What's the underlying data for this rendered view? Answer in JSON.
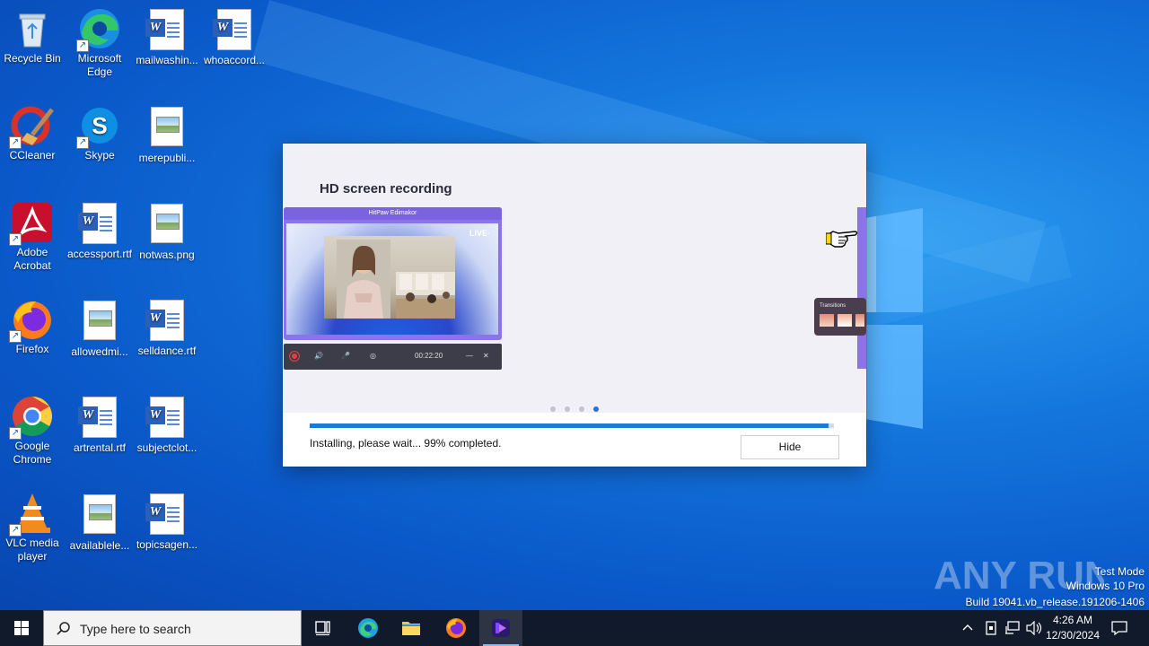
{
  "desktop": {
    "icons": [
      {
        "name": "recycle-bin",
        "label": "Recycle Bin",
        "kind": "recycle"
      },
      {
        "name": "microsoft-edge",
        "label": "Microsoft Edge",
        "kind": "edge"
      },
      {
        "name": "mailwashin",
        "label": "mailwashin...",
        "kind": "word"
      },
      {
        "name": "whoaccord",
        "label": "whoaccord...",
        "kind": "word"
      },
      {
        "name": "ccleaner",
        "label": "CCleaner",
        "kind": "ccleaner"
      },
      {
        "name": "skype",
        "label": "Skype",
        "kind": "skype"
      },
      {
        "name": "merepubli",
        "label": "merepubli...",
        "kind": "image"
      },
      {
        "name": "adobe-acrobat",
        "label": "Adobe Acrobat",
        "kind": "acrobat"
      },
      {
        "name": "accessport",
        "label": "accessport.rtf",
        "kind": "word"
      },
      {
        "name": "notwas",
        "label": "notwas.png",
        "kind": "image"
      },
      {
        "name": "firefox",
        "label": "Firefox",
        "kind": "firefox"
      },
      {
        "name": "allowedmi",
        "label": "allowedmi...",
        "kind": "image"
      },
      {
        "name": "selldance",
        "label": "selldance.rtf",
        "kind": "word"
      },
      {
        "name": "google-chrome",
        "label": "Google Chrome",
        "kind": "chrome"
      },
      {
        "name": "artrental",
        "label": "artrental.rtf",
        "kind": "word"
      },
      {
        "name": "subjectclot",
        "label": "subjectclot...",
        "kind": "word"
      },
      {
        "name": "vlc",
        "label": "VLC media player",
        "kind": "vlc"
      },
      {
        "name": "availablele",
        "label": "availablele...",
        "kind": "image"
      },
      {
        "name": "topicsagen",
        "label": "topicsagen...",
        "kind": "word"
      }
    ]
  },
  "installer": {
    "slide_title": "HD screen recording",
    "mock_app_title": "HitPaw Edimakor",
    "mock_live": "LIVE·",
    "mock_timer": "00:22:20",
    "transitions_label": "Transitions",
    "dots_total": 4,
    "dots_active": 4,
    "progress_percent": 99,
    "status_text": "Installing, please wait... 99% completed.",
    "hide_label": "Hide"
  },
  "watermark": {
    "brand": "ANY RUN",
    "test_mode": "Test Mode",
    "edition": "Windows 10 Pro",
    "build": "Build 19041.vb_release.191206-1406"
  },
  "taskbar": {
    "search_placeholder": "Type here to search",
    "time": "4:26 AM",
    "date": "12/30/2024"
  },
  "colors": {
    "accent": "#1a7ad4",
    "taskbar": "#101a2b",
    "desktop": "#1476dd",
    "mock_purple": "#8a74e8"
  }
}
